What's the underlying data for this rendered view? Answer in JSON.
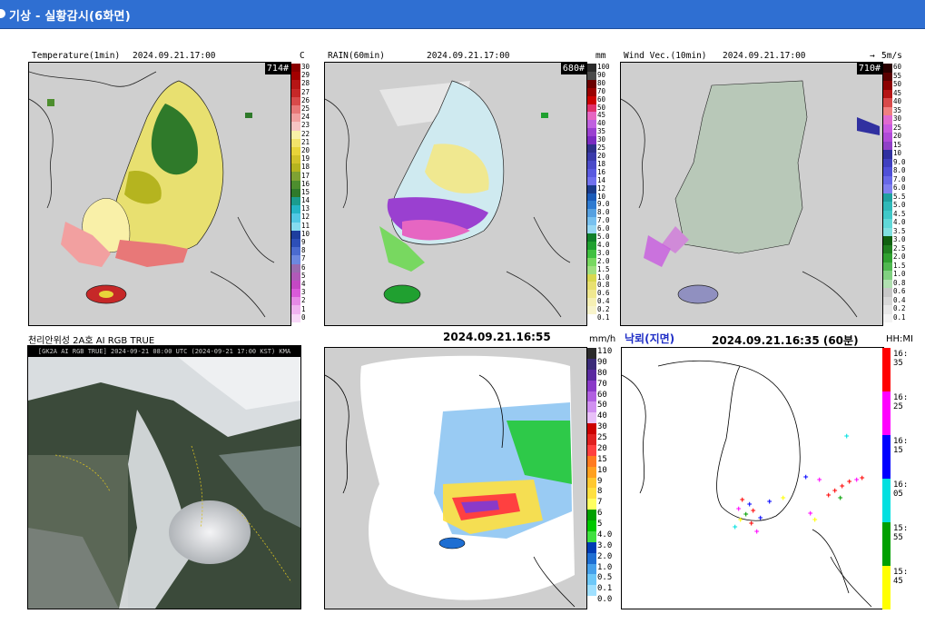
{
  "window": {
    "title": "기상 - 실황감시(6화면)"
  },
  "panels": {
    "temperature": {
      "title": "Temperature(1min)",
      "timestamp": "2024.09.21.17:00",
      "unit": "C",
      "count": "714#",
      "legend_labels": [
        "30",
        "29",
        "28",
        "27",
        "26",
        "25",
        "24",
        "23",
        "22",
        "21",
        "20",
        "19",
        "18",
        "17",
        "16",
        "15",
        "14",
        "13",
        "12",
        "11",
        "10",
        "9",
        "8",
        "7",
        "6",
        "5",
        "4",
        "3",
        "2",
        "1",
        "0"
      ],
      "legend_colors": [
        "#8b0000",
        "#a30000",
        "#b51515",
        "#c62828",
        "#d84a4a",
        "#e87878",
        "#f2a0a0",
        "#f7c4c4",
        "#f9f0a8",
        "#f3e36b",
        "#e8d43a",
        "#d1c22a",
        "#b5b41f",
        "#7fa233",
        "#4d8e2e",
        "#2f7a2a",
        "#1b9c8e",
        "#25b5c6",
        "#52c8e4",
        "#86dcf0",
        "#1e3e9e",
        "#2d4fb8",
        "#4b6bd0",
        "#6d88e0",
        "#9a6bb0",
        "#b05ab8",
        "#c448c4",
        "#d95ad9",
        "#e68ae6",
        "#f0b3f0",
        "#f8d8f8"
      ]
    },
    "rain": {
      "title": "RAIN(60min)",
      "timestamp": "2024.09.21.17:00",
      "unit": "mm",
      "count": "680#",
      "legend_labels": [
        "100",
        "90",
        "80",
        "70",
        "60",
        "50",
        "45",
        "40",
        "35",
        "30",
        "25",
        "20",
        "18",
        "16",
        "14",
        "12",
        "10",
        "9.0",
        "8.0",
        "7.0",
        "6.0",
        "5.0",
        "4.0",
        "3.0",
        "2.0",
        "1.5",
        "1.0",
        "0.8",
        "0.6",
        "0.4",
        "0.2",
        "0.1"
      ],
      "legend_colors": [
        "#2b2b2b",
        "#4a4a4a",
        "#6b0000",
        "#9a0000",
        "#cc0000",
        "#e0306a",
        "#e666c2",
        "#c060e0",
        "#9a40d0",
        "#7a2ac0",
        "#30308a",
        "#3a3aaa",
        "#4a4ac8",
        "#5a5ae0",
        "#7070ee",
        "#1a3a8a",
        "#1a5ab8",
        "#2e7ad0",
        "#56a0e0",
        "#78c0ee",
        "#98d8f4",
        "#10802a",
        "#20a030",
        "#40c040",
        "#78d860",
        "#a0e080",
        "#d8d850",
        "#e8e070",
        "#f0e890",
        "#f6f0b4",
        "#f8f4cc",
        "#ffffff"
      ]
    },
    "wind": {
      "title": "Wind Vec.(10min)",
      "timestamp": "2024.09.21.17:00",
      "unit": "5m/s",
      "count": "710#",
      "legend_labels": [
        "60",
        "55",
        "50",
        "45",
        "40",
        "35",
        "30",
        "25",
        "20",
        "15",
        "10",
        "9.0",
        "8.0",
        "7.0",
        "6.0",
        "5.5",
        "5.0",
        "4.5",
        "4.0",
        "3.5",
        "3.0",
        "2.5",
        "2.0",
        "1.5",
        "1.0",
        "0.8",
        "0.6",
        "0.4",
        "0.2",
        "0.1"
      ],
      "legend_colors": [
        "#2b0000",
        "#5a0000",
        "#8b0000",
        "#b51515",
        "#d84a4a",
        "#f08080",
        "#e06ad0",
        "#c85ae0",
        "#b04ad8",
        "#9040c8",
        "#3030a0",
        "#4040c0",
        "#5050d8",
        "#6868e8",
        "#8080f0",
        "#20a0a0",
        "#30b8b8",
        "#40c8c8",
        "#60d8d8",
        "#80e0e0",
        "#106010",
        "#208020",
        "#30a030",
        "#50b850",
        "#80d080",
        "#b0e0b0",
        "#c8c8c8",
        "#d8d8d8",
        "#e8e8e8",
        "#f4f4f4"
      ]
    },
    "satellite": {
      "title": "천리안위성 2A호 AI RGB TRUE",
      "banner": "[GK2A AI RGB TRUE] 2024-09-21 08:00 UTC (2024-09-21 17:00 KST) KMA"
    },
    "radar": {
      "timestamp": "2024.09.21.16:55",
      "unit": "mm/h",
      "legend_labels": [
        "110",
        "90",
        "80",
        "70",
        "60",
        "50",
        "40",
        "30",
        "25",
        "20",
        "15",
        "10",
        "9",
        "8",
        "7",
        "6",
        "5",
        "4.0",
        "3.0",
        "2.0",
        "1.0",
        "0.5",
        "0.1",
        "0.0"
      ],
      "legend_colors": [
        "#2b2b2b",
        "#3a2a78",
        "#5a2aa0",
        "#8a3ac8",
        "#b060e0",
        "#d090f0",
        "#e8c0f8",
        "#cc0000",
        "#e02020",
        "#ff4040",
        "#ff7a20",
        "#ffa020",
        "#ffc830",
        "#ffe040",
        "#ffff60",
        "#00a000",
        "#00c800",
        "#40e040",
        "#003cb4",
        "#1e6ed2",
        "#46a0ea",
        "#6ec8f8",
        "#a0e0ff",
        "#ffffff"
      ]
    },
    "lightning": {
      "title": "낙뢰(지면)",
      "timestamp": "2024.09.21.16:35 (60분)",
      "unit": "HH:MI",
      "legend_labels": [
        "16:\n35",
        "16:\n25",
        "16:\n15",
        "16:\n05",
        "15:\n55",
        "15:\n45"
      ],
      "legend_colors": [
        "#ff0000",
        "#ff00ff",
        "#0000ff",
        "#00e0e0",
        "#00a000",
        "#ffff00"
      ]
    }
  }
}
